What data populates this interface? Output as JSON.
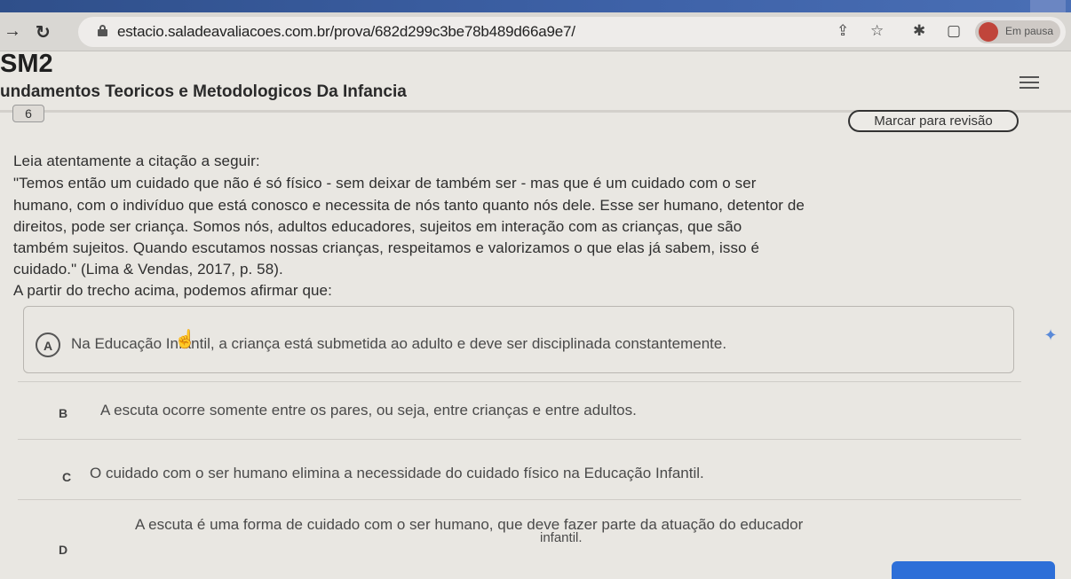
{
  "browser": {
    "url": "estacio.saladeavaliacoes.com.br/prova/682d299c3be78b489d66a9e7/",
    "profile_status": "Em pausa",
    "icons": [
      "forward-arrow-icon",
      "reload-icon",
      "lock-icon",
      "share-icon",
      "star-icon",
      "extension-icon",
      "sidebar-icon"
    ]
  },
  "header": {
    "course_code": "SM2",
    "course_name": "undamentos Teoricos e Metodologicos Da Infancia"
  },
  "question": {
    "number": "6",
    "review_label": "Marcar para revisão",
    "lines": [
      "Leia atentamente a citação a seguir:",
      "\"Temos então um cuidado que não é só físico - sem deixar de também ser - mas que é um cuidado com o ser",
      "humano, com o indivíduo que está conosco e necessita de nós tanto quanto nós dele. Esse ser humano, detentor de",
      "direitos, pode ser criança. Somos nós, adultos educadores, sujeitos em interação com as crianças, que são",
      "também sujeitos. Quando escutamos nossas crianças, respeitamos e valorizamos o que elas já sabem, isso é",
      "cuidado.\" (Lima & Vendas, 2017, p. 58).",
      "A partir do trecho acima, podemos afirmar que:"
    ]
  },
  "options": [
    {
      "letter": "A",
      "text": "Na Educação Infantil, a criança está submetida ao adulto e deve ser disciplinada constantemente."
    },
    {
      "letter": "B",
      "text": "A escuta ocorre somente entre os pares, ou seja, entre crianças e entre adultos."
    },
    {
      "letter": "C",
      "text": "O cuidado com o ser humano elimina a necessidade do cuidado físico na Educação Infantil."
    },
    {
      "letter": "D",
      "text_line1": "A escuta é uma forma de cuidado com o ser humano, que deve fazer parte da atuação do educador",
      "text_line2": "infantil."
    }
  ],
  "colors": {
    "accent": "#2d6fd8",
    "window_bar": "#3e62a8",
    "page_background": "#e9e7e2"
  }
}
